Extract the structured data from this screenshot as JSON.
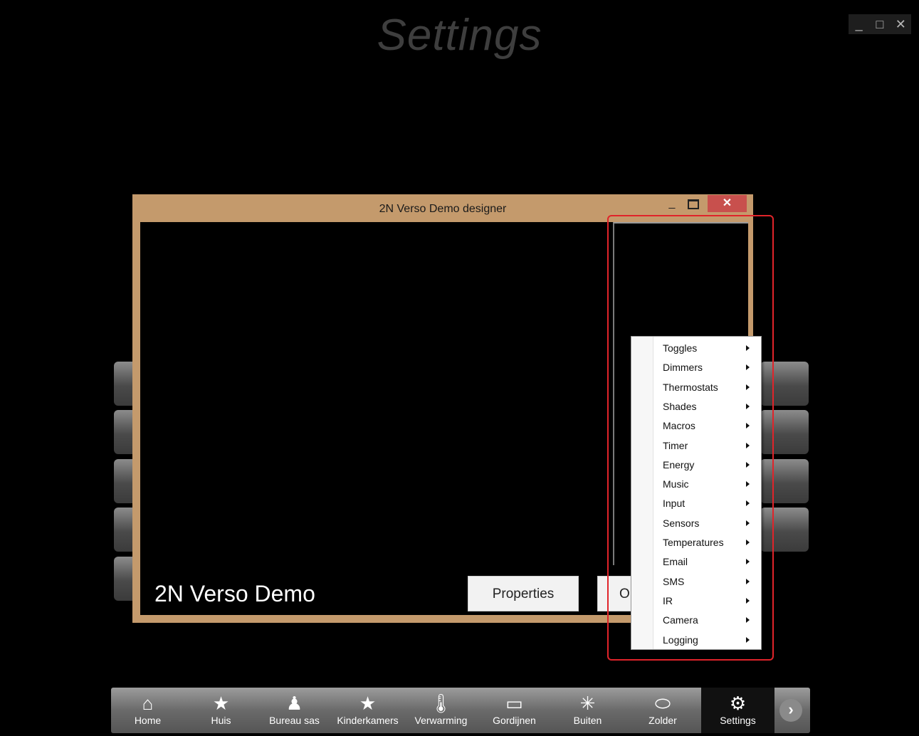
{
  "app": {
    "title": "Settings",
    "window_controls": [
      "_",
      "□",
      "✕"
    ]
  },
  "dialog": {
    "title": "2N Verso Demo designer",
    "min_label": "_",
    "close_label": "✕",
    "device_name": "2N Verso Demo",
    "properties_label": "Properties",
    "other_button_visible_text": "O"
  },
  "context_menu": {
    "items": [
      {
        "label": "Toggles"
      },
      {
        "label": "Dimmers"
      },
      {
        "label": "Thermostats"
      },
      {
        "label": "Shades"
      },
      {
        "label": "Macros"
      },
      {
        "label": "Timer"
      },
      {
        "label": "Energy"
      },
      {
        "label": "Music"
      },
      {
        "label": "Input"
      },
      {
        "label": "Sensors"
      },
      {
        "label": "Temperatures"
      },
      {
        "label": "Email"
      },
      {
        "label": "SMS"
      },
      {
        "label": "IR"
      },
      {
        "label": "Camera"
      },
      {
        "label": "Logging"
      }
    ]
  },
  "nav": {
    "items": [
      {
        "label": "Home",
        "icon": "house-icon"
      },
      {
        "label": "Huis",
        "icon": "star-icon"
      },
      {
        "label": "Bureau sas",
        "icon": "person-icon"
      },
      {
        "label": "Kinderkamers",
        "icon": "star-icon"
      },
      {
        "label": "Verwarming",
        "icon": "thermometer-icon"
      },
      {
        "label": "Gordijnen",
        "icon": "window-icon"
      },
      {
        "label": "Buiten",
        "icon": "sun-icon"
      },
      {
        "label": "Zolder",
        "icon": "ellipse-icon"
      },
      {
        "label": "Settings",
        "icon": "gear-icon",
        "active": true
      }
    ],
    "next_label": "›"
  },
  "colors": {
    "dialog_frame": "#c49a6c",
    "highlight": "#e0242a",
    "close_button": "#c8504d"
  }
}
